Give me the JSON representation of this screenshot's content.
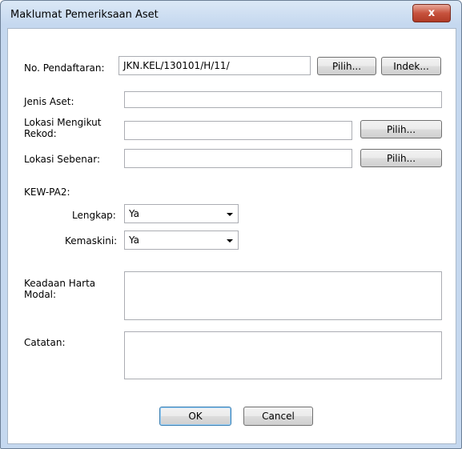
{
  "window": {
    "title": "Maklumat Pemeriksaan Aset",
    "close_glyph": "x"
  },
  "fields": {
    "no_pendaftaran": {
      "label": "No. Pendaftaran:",
      "value": "JKN.KEL/130101/H/11/"
    },
    "jenis_aset": {
      "label": "Jenis Aset:",
      "value": ""
    },
    "lokasi_mengikut_rekod": {
      "label_line1": "Lokasi Mengikut",
      "label_line2": "Rekod:",
      "value": ""
    },
    "lokasi_sebenar": {
      "label": "Lokasi Sebenar:",
      "value": ""
    },
    "kew_pa2": {
      "label": "KEW-PA2:"
    },
    "lengkap": {
      "label": "Lengkap:",
      "value": "Ya"
    },
    "kemaskini": {
      "label": "Kemaskini:",
      "value": "Ya"
    },
    "keadaan_harta_modal": {
      "label_line1": "Keadaan Harta",
      "label_line2": "Modal:",
      "value": ""
    },
    "catatan": {
      "label": "Catatan:",
      "value": ""
    }
  },
  "buttons": {
    "pilih": "Pilih...",
    "indek": "Indek...",
    "ok": "OK",
    "cancel": "Cancel"
  }
}
